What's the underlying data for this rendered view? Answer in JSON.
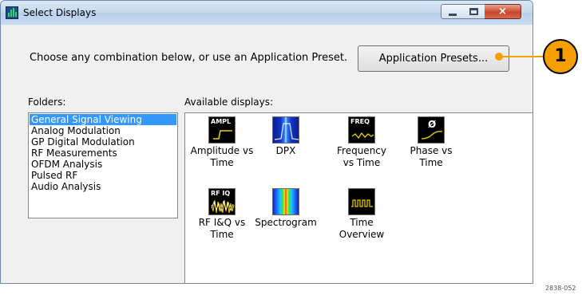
{
  "window": {
    "title": "Select Displays",
    "close_glyph": "×"
  },
  "prompt": "Choose any combination below, or use an Application Preset.",
  "presets_button": "Application Presets...",
  "folders": {
    "label": "Folders:",
    "items": [
      "General Signal Viewing",
      "Analog Modulation",
      "GP Digital Modulation",
      "RF Measurements",
      "OFDM Analysis",
      "Pulsed RF",
      "Audio Analysis"
    ],
    "selected_index": 0
  },
  "displays": {
    "label": "Available displays:",
    "items": [
      {
        "icon": "amplitude-vs-time-icon",
        "icon_text": "AMPL",
        "label_1": "Amplitude vs",
        "label_2": "Time"
      },
      {
        "icon": "dpx-icon",
        "icon_text": "",
        "label_1": "DPX",
        "label_2": ""
      },
      {
        "icon": "frequency-vs-time-icon",
        "icon_text": "FREQ",
        "label_1": "Frequency",
        "label_2": "vs Time"
      },
      {
        "icon": "phase-vs-time-icon",
        "icon_text": "Ø",
        "label_1": "Phase vs",
        "label_2": "Time"
      },
      {
        "icon": "rf-iq-vs-time-icon",
        "icon_text": "RF IQ",
        "label_1": "RF I&Q vs",
        "label_2": "Time"
      },
      {
        "icon": "spectrogram-icon",
        "icon_text": "",
        "label_1": "Spectrogram",
        "label_2": ""
      },
      {
        "icon": "time-overview-icon",
        "icon_text": "",
        "label_1": "Time",
        "label_2": "Overview"
      }
    ]
  },
  "callout_number": "1",
  "figure_number": "2838-052",
  "colors": {
    "selection": "#3399ff",
    "callout": "#f5a000",
    "close_button": "#c8452d"
  }
}
